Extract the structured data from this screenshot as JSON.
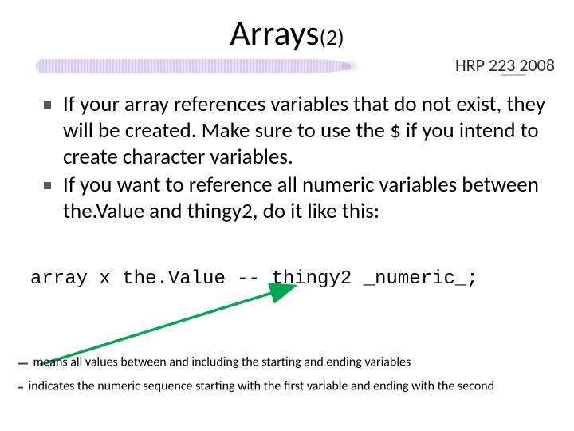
{
  "title": {
    "main": "Arrays",
    "sub": "(2)"
  },
  "course_tag": "HRP 223 2008",
  "bullets": [
    "If your array references variables that do not exist, they will be created.  Make sure to use the $ if you intend to create character variables.",
    "If you want to reference all numeric variables between the.Value and thingy2, do it like this:"
  ],
  "code_line": "array x the.Value -- thingy2 _numeric_;",
  "notes": {
    "double_dash_lead": "--",
    "double_dash_text": "means all values between and including the starting and ending variables",
    "single_dash_lead": "-",
    "single_dash_text": "indicates the numeric sequence starting with the first variable and ending with the second"
  },
  "colors": {
    "arrow": "#00a84f",
    "brush": "#b7a6d6"
  }
}
